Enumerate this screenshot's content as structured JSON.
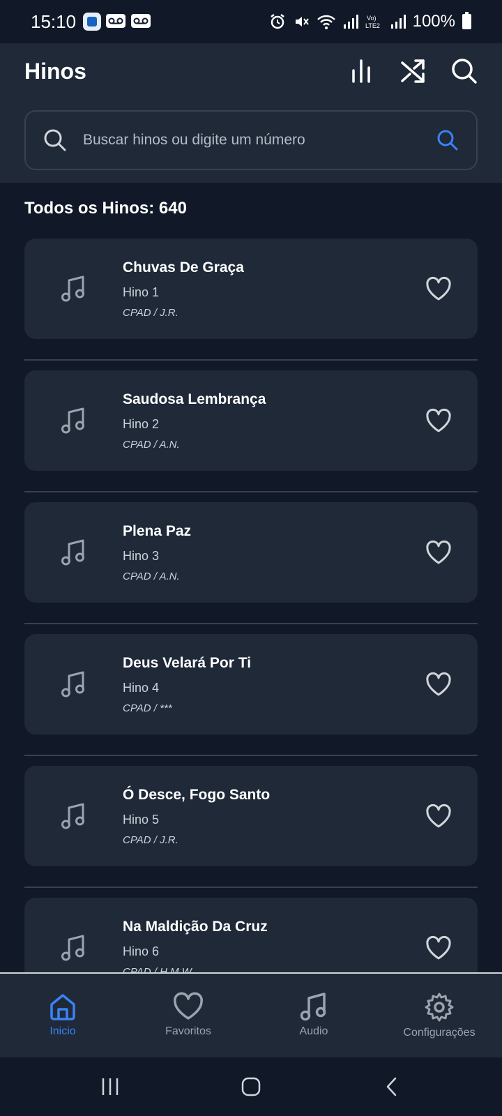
{
  "status_bar": {
    "time": "15:10",
    "battery": "100%",
    "network": "LTE2"
  },
  "header": {
    "title": "Hinos"
  },
  "search": {
    "placeholder": "Buscar hinos ou digite um número"
  },
  "section": {
    "title": "Todos os Hinos: 640"
  },
  "hymns": [
    {
      "title": "Chuvas De Graça",
      "number": "Hino 1",
      "author": "CPAD / J.R."
    },
    {
      "title": "Saudosa Lembrança",
      "number": "Hino 2",
      "author": "CPAD / A.N."
    },
    {
      "title": "Plena Paz",
      "number": "Hino 3",
      "author": "CPAD / A.N."
    },
    {
      "title": "Deus Velará Por Ti",
      "number": "Hino 4",
      "author": "CPAD / ***"
    },
    {
      "title": "Ó Desce, Fogo Santo",
      "number": "Hino 5",
      "author": "CPAD / J.R."
    },
    {
      "title": "Na Maldição Da Cruz",
      "number": "Hino 6",
      "author": "CPAD / H.M.W."
    }
  ],
  "bottom_nav": {
    "items": [
      {
        "label": "Inicio",
        "icon": "home-icon",
        "active": true
      },
      {
        "label": "Favoritos",
        "icon": "heart-icon",
        "active": false
      },
      {
        "label": "Audio",
        "icon": "music-note-icon",
        "active": false
      },
      {
        "label": "Configurações",
        "icon": "gear-icon",
        "active": false
      }
    ]
  },
  "colors": {
    "background": "#111827",
    "surface": "#1f2937",
    "accent": "#3b82f6",
    "muted": "#9ca3af"
  }
}
